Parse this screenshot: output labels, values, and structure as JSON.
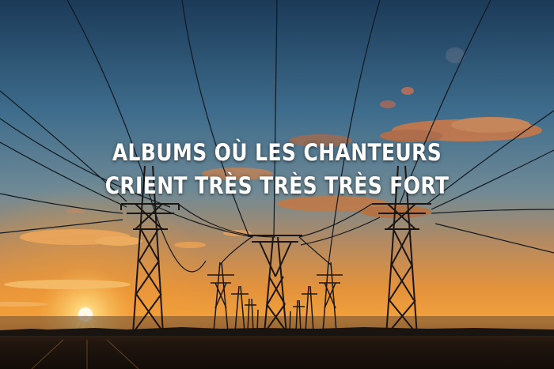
{
  "headline": {
    "line1": "ALBUMS OÙ LES CHANTEURS",
    "line2": "CRIENT TRÈS TRÈS TRÈS FORT"
  },
  "photo": {
    "subject": "power-line pylons at sunset",
    "colors": {
      "sky_top": "#1d3f5e",
      "sky_mid": "#4f7d99",
      "horizon_glow": "#f3a13a",
      "sun": "#fff4c8",
      "ground": "#1a1410",
      "silhouette": "#1b1613"
    }
  }
}
